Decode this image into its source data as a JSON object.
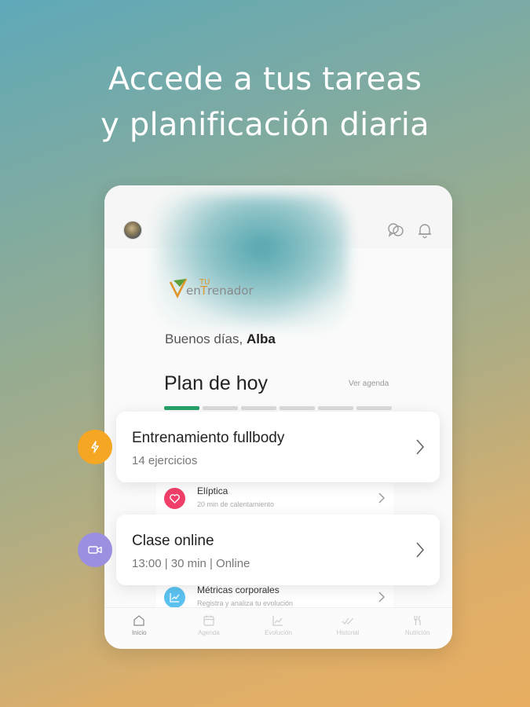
{
  "headline": {
    "line1": "Accede a tus tareas",
    "line2": "y planificación diaria"
  },
  "app": {
    "logo_text": "VenTuEntrenador",
    "greeting_prefix": "Buenos días,",
    "user_name": "Alba",
    "plan_title": "Plan de hoy",
    "agenda_link": "Ver agenda",
    "progress": {
      "completed": 1,
      "total": 6
    }
  },
  "cards": [
    {
      "title": "Entrenamiento fullbody",
      "subtitle": "14 ejercicios",
      "icon": "lightning-icon",
      "color": "#f5a623"
    },
    {
      "title": "Clase online",
      "subtitle": "13:00 | 30 min | Online",
      "icon": "video-camera-icon",
      "color": "#9b8fe0"
    }
  ],
  "mini_items": [
    {
      "title": "Elíptica",
      "subtitle": "20 min de calentamiento",
      "icon": "heart-icon",
      "color": "#f0406a"
    },
    {
      "title": "Métricas corporales",
      "subtitle": "Registra y analiza tu evolución",
      "icon": "chart-icon",
      "color": "#5bc2f0"
    }
  ],
  "nav": [
    {
      "label": "Inicio",
      "icon": "home-icon",
      "active": true
    },
    {
      "label": "Agenda",
      "icon": "calendar-icon",
      "active": false
    },
    {
      "label": "Evolución",
      "icon": "trend-icon",
      "active": false
    },
    {
      "label": "Historial",
      "icon": "check-icon",
      "active": false
    },
    {
      "label": "Nutrición",
      "icon": "cutlery-icon",
      "active": false
    }
  ],
  "colors": {
    "accent_green": "#26a16a",
    "logo_orange": "#e0962e",
    "logo_green": "#5c9e3a"
  }
}
